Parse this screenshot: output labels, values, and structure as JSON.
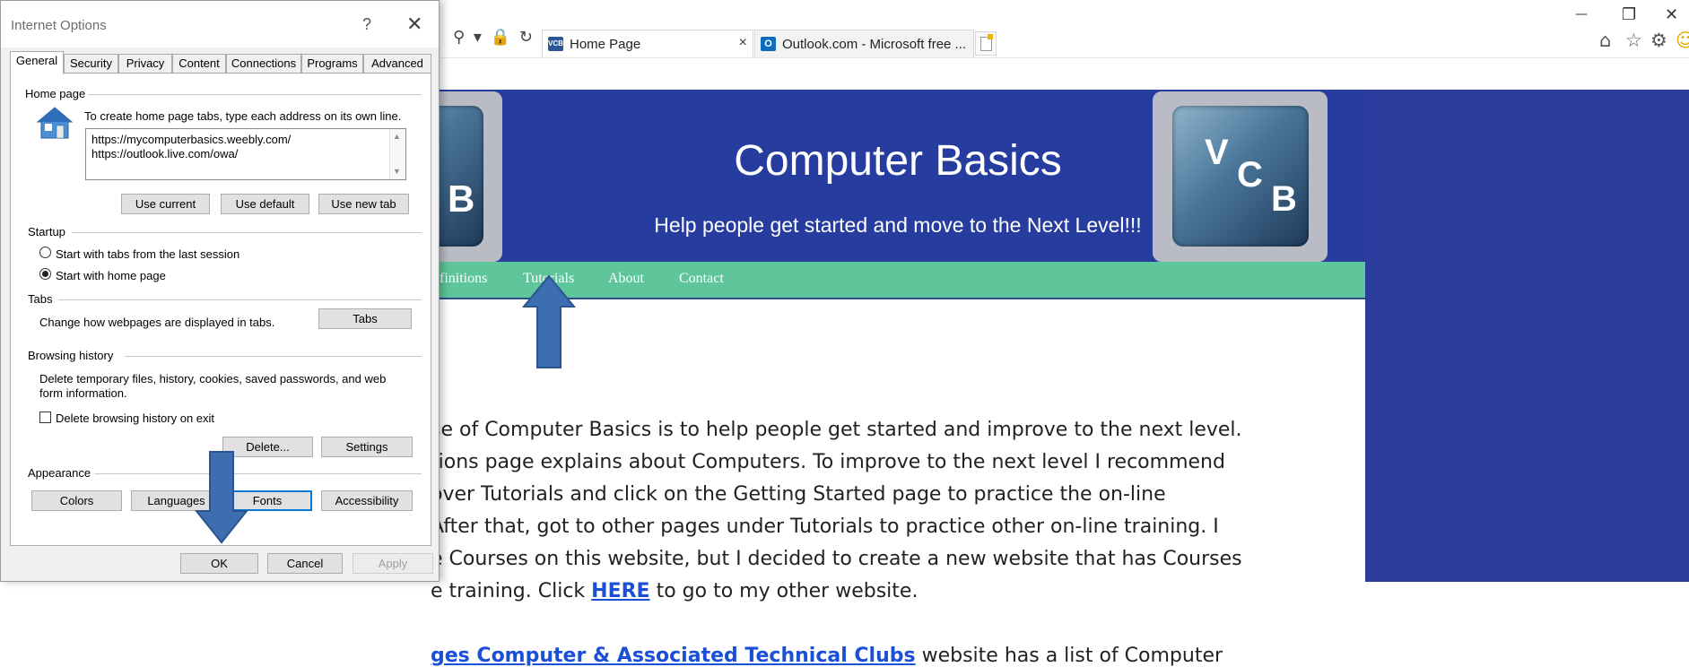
{
  "browser": {
    "address_tail": "⚲ ▾ 🔒 ↻",
    "tabs": [
      {
        "label": "Home Page",
        "favicon": "VCB",
        "close": "×",
        "active": true
      },
      {
        "label": "Outlook.com - Microsoft free ...",
        "favicon": "O",
        "active": false
      }
    ],
    "window_controls": {
      "minimize": "—",
      "restore": "❐",
      "close": "✕"
    },
    "toolbar_icons": [
      "home-icon",
      "favorites-star-icon",
      "settings-gear-icon",
      "smiley-icon"
    ]
  },
  "website": {
    "logo_left_letter": "B",
    "logo_right_letters": [
      "V",
      "C",
      "B"
    ],
    "title": "Computer Basics",
    "subtitle": "Help people get started and move to the Next Level!!!",
    "nav": [
      "finitions",
      "Tutorials",
      "About",
      "Contact"
    ],
    "content_lines": [
      "se of Computer Basics is to help people get started and improve to the next level.",
      "tions page explains about Computers.  To improve to the next level I recommend",
      "over Tutorials and click on the Getting Started page to practice the on-line",
      "After that, got to other pages under Tutorials to practice other on-line training.  I",
      "e Courses on this website, but I decided to create a new website that has Courses"
    ],
    "line6_prefix": "e training.  Click ",
    "line6_link": "HERE",
    "line6_suffix": " to go to my other website.",
    "line7_link": "ges Computer & Associated Technical Clubs",
    "line7_suffix": " website has a list of Computer"
  },
  "dialog": {
    "title": "Internet Options",
    "help": "?",
    "close": "✕",
    "tabs": [
      "General",
      "Security",
      "Privacy",
      "Content",
      "Connections",
      "Programs",
      "Advanced"
    ],
    "home_page": {
      "group": "Home page",
      "instruction": "To create home page tabs, type each address on its own line.",
      "urls": [
        "https://mycomputerbasics.weebly.com/",
        "https://outlook.live.com/owa/"
      ],
      "buttons": [
        "Use current",
        "Use default",
        "Use new tab"
      ]
    },
    "startup": {
      "group": "Startup",
      "options": [
        "Start with tabs from the last session",
        "Start with home page"
      ],
      "selected": "Start with home page"
    },
    "tabs_group": {
      "group": "Tabs",
      "text": "Change how webpages are displayed in tabs.",
      "button": "Tabs"
    },
    "browsing_history": {
      "group": "Browsing history",
      "text_line1": "Delete temporary files, history, cookies, saved passwords, and web",
      "text_line2": "form information.",
      "checkbox": "Delete browsing history on exit",
      "checked": false,
      "delete_button": "Delete...",
      "settings_button": "Settings"
    },
    "appearance": {
      "group": "Appearance",
      "buttons": [
        "Colors",
        "Languages",
        "Fonts",
        "Accessibility"
      ]
    },
    "footer": {
      "ok": "OK",
      "cancel": "Cancel",
      "apply": "Apply"
    }
  },
  "colors": {
    "site_blue": "#263c9e",
    "nav_green": "#5fc59a",
    "arrow_blue": "#3d6fb0",
    "link_blue": "#1a4fd6"
  }
}
